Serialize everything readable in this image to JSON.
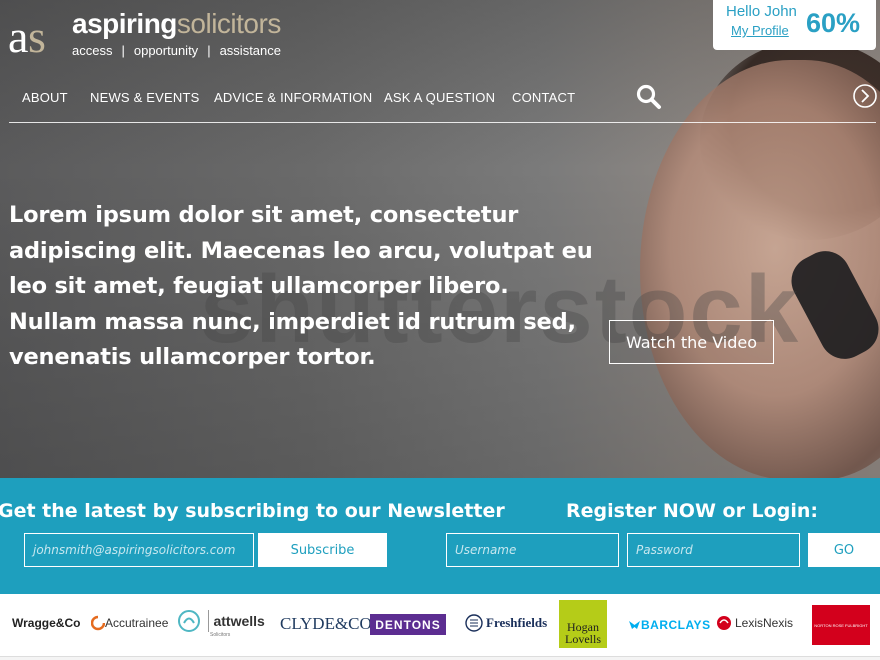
{
  "brand": {
    "logo_mark": "aS",
    "name_part1": "aspiring",
    "name_part2": "solicitors",
    "tagline": [
      "access",
      "opportunity",
      "assistance"
    ],
    "tagline_sep": "|"
  },
  "profile": {
    "greeting": "Hello John",
    "link_label": "My Profile",
    "completion": "60%"
  },
  "nav": {
    "items": [
      "ABOUT",
      "NEWS & EVENTS",
      "ADVICE & INFORMATION",
      "ASK A QUESTION",
      "CONTACT"
    ],
    "search_icon": "search-icon",
    "next_icon": "chevron-right-circle-icon"
  },
  "hero": {
    "text": "Lorem ipsum dolor sit amet, consectetur adipiscing elit. Maecenas leo arcu, volutpat eu leo sit amet, feugiat ullamcorper libero. Nullam massa nunc, imperdiet id rutrum sed, venenatis ullamcorper tortor.",
    "watermark": "shutterstock",
    "video_button": "Watch the Video"
  },
  "newsletter": {
    "heading": "Get the latest by subscribing to our Newsletter",
    "email_placeholder": "johnsmith@aspiringsolicitors.com",
    "subscribe_label": "Subscribe"
  },
  "login": {
    "heading": "Register NOW or Login:",
    "username_placeholder": "Username",
    "password_placeholder": "Password",
    "go_label": "GO"
  },
  "partners": {
    "wragge": "Wragge&Co",
    "accutrainee": "Accutrainee",
    "attwells": "attwells",
    "attwells_sub": "Solicitors",
    "clyde": "CLYDE&CO",
    "dentons": "DENTONS",
    "freshfields": "Freshfields",
    "hogan_1": "Hogan",
    "hogan_2": "Lovells",
    "barclays": "BARCLAYS",
    "lexisnexis": "LexisNexis",
    "nortonrose": "NORTON ROSE FULBRIGHT"
  },
  "colors": {
    "accent": "#1e9fbe",
    "link_blue": "#2aa0c4",
    "logo_gold": "#c2b59a",
    "dentons_purple": "#5c2d91",
    "hogan_green": "#b5cc18",
    "norton_red": "#d3001c"
  }
}
